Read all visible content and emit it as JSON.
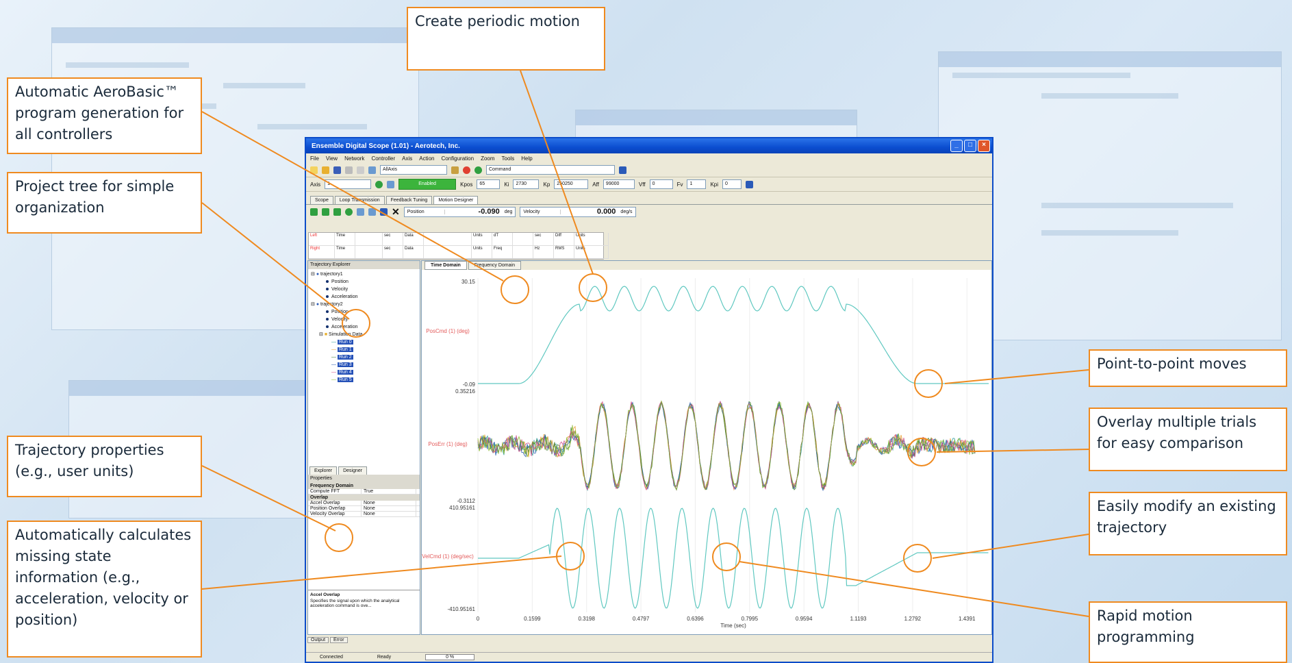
{
  "callouts": {
    "aerobasic": "Automatic AeroBasic™ program generation for all controllers",
    "project_tree": "Project tree for simple organization",
    "traj_props": "Trajectory properties (e.g., user units)",
    "auto_calc": "Automatically calculates missing state information (e.g., acceleration, velocity or position)",
    "periodic": "Create periodic motion",
    "p2p": "Point-to-point moves",
    "overlay": "Overlay multiple trials for easy comparison",
    "modify": "Easily modify an existing trajectory",
    "rapid": "Rapid motion programming"
  },
  "window": {
    "title": "Ensemble Digital Scope (1.01) - Aerotech, Inc.",
    "menu": [
      "File",
      "View",
      "Network",
      "Controller",
      "Axis",
      "Action",
      "Configuration",
      "Zoom",
      "Tools",
      "Help"
    ],
    "toolbar": {
      "combo_all": "AllAxis",
      "command": "Command",
      "axis_label": "Axis",
      "axis_value": "1",
      "enabled": "Enabled",
      "kpos": "Kpos",
      "kpos_v": "65",
      "ki": "Ki",
      "ki_v": "2730",
      "kp": "Kp",
      "kp_v": "250250",
      "aff": "Aff",
      "aff_v": "99000",
      "vff": "Vff",
      "vff_v": "0",
      "fv": "Fv",
      "fv_v": "1",
      "kpi": "Kpi",
      "kpi_v": "0"
    },
    "tabs": [
      "Scope",
      "Loop Transmission",
      "Feedback Tuning",
      "Motion Designer"
    ],
    "readouts": [
      {
        "label": "Position",
        "value": "-0.090",
        "unit": "deg"
      },
      {
        "label": "Velocity",
        "value": "0.000",
        "unit": "deg/s"
      }
    ],
    "cursor_rows": [
      [
        "Left",
        "Time",
        "",
        "sec",
        "Data",
        "",
        "Units",
        "dT",
        "",
        "sec",
        "Diff",
        "Units"
      ],
      [
        "Right",
        "Time",
        "",
        "sec",
        "Data",
        "",
        "Units",
        "Freq",
        "",
        "Hz",
        "RMS",
        "Units"
      ]
    ],
    "explorer": {
      "title": "Trajectory Explorer",
      "items": [
        "trajectory1",
        "Position",
        "Velocity",
        "Acceleration",
        "trajectory2",
        "Position",
        "Velocity",
        "Acceleration",
        "Simulation Data"
      ],
      "runs": [
        "Run 0",
        "Run 1",
        "Run 2",
        "Run 3",
        "Run 4",
        "Run 5"
      ],
      "bottom_tabs": [
        "Explorer",
        "Designer"
      ]
    },
    "properties": {
      "title": "Properties",
      "groups": [
        {
          "name": "Frequency Domain",
          "rows": [
            [
              "Compute FFT",
              "True"
            ]
          ]
        },
        {
          "name": "Overlap",
          "rows": [
            [
              "Accel Overlap",
              "None"
            ],
            [
              "Position Overlap",
              "None"
            ],
            [
              "Velocity Overlap",
              "None"
            ]
          ]
        }
      ],
      "desc_title": "Accel Overlap",
      "desc_text": "Specifies the signal upon which the analytical acceleration command is ove..."
    },
    "plot_tabs": [
      "Time Domain",
      "Frequency Domain"
    ],
    "output_tabs": [
      "Output",
      "Error"
    ],
    "status": {
      "connected": "Connected",
      "ready": "Ready",
      "progress": "0 %"
    }
  },
  "chart_data": [
    {
      "type": "line",
      "ylabel": "PosCmd (1) (deg)",
      "ylim": [
        -0.09,
        30.15
      ],
      "yticks": [
        "30.15",
        "-0.09"
      ]
    },
    {
      "type": "line",
      "ylabel": "PosErr (1) (deg)",
      "ylim": [
        -0.3112,
        0.35216
      ],
      "yticks": [
        "0.35216",
        "-0.3112"
      ],
      "series": [
        {
          "name": "Run 0"
        },
        {
          "name": "Run 1"
        },
        {
          "name": "Run 2"
        },
        {
          "name": "Run 3"
        },
        {
          "name": "Run 4"
        },
        {
          "name": "Run 5"
        }
      ]
    },
    {
      "type": "line",
      "ylabel": "VelCmd (1) (deg/sec)",
      "ylim": [
        -410.95161,
        410.95161
      ],
      "yticks": [
        "410.95161",
        "-410.95161"
      ],
      "xlabel": "Time (sec)",
      "xticks": [
        "0",
        "0.1599",
        "0.3198",
        "0.4797",
        "0.6396",
        "0.7995",
        "0.9594",
        "1.1193",
        "1.2792",
        "1.4391"
      ]
    }
  ],
  "colors": {
    "accent": "#ef8a1f",
    "trace": "#5fc8c0",
    "run_colors": [
      "#2a9a9a",
      "#e69a2a",
      "#3a7a2a",
      "#2a5ab0",
      "#d04a8a",
      "#8ab82a"
    ]
  }
}
